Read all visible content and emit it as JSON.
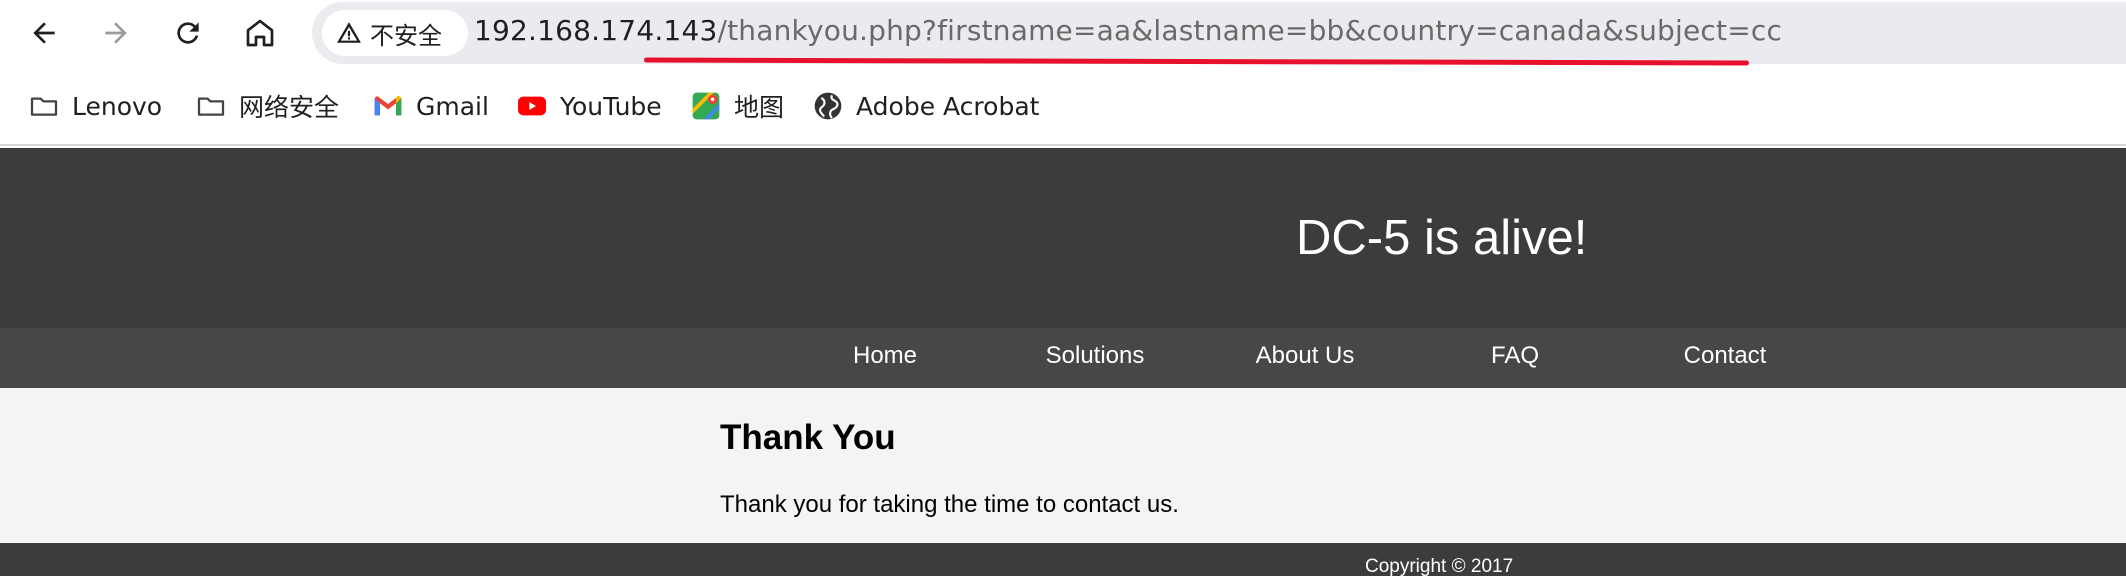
{
  "browser": {
    "security_label": "不安全",
    "url_host": "192.168.174.143",
    "url_path": "/thankyou.php?firstname=aa&lastname=bb&country=canada&subject=cc",
    "annotation_color": "#e8112d",
    "icons": [
      "back-arrow-icon",
      "forward-arrow-icon",
      "reload-icon",
      "home-icon",
      "warning-triangle-icon"
    ]
  },
  "bookmarks": [
    {
      "label": "Lenovo",
      "icon": "folder-icon"
    },
    {
      "label": "网络安全",
      "icon": "folder-icon"
    },
    {
      "label": "Gmail",
      "icon": "gmail-icon"
    },
    {
      "label": "YouTube",
      "icon": "youtube-icon"
    },
    {
      "label": "地图",
      "icon": "maps-icon"
    },
    {
      "label": "Adobe Acrobat",
      "icon": "globe-icon"
    }
  ],
  "site": {
    "title": "DC-5 is alive!",
    "nav": [
      "Home",
      "Solutions",
      "About Us",
      "FAQ",
      "Contact"
    ],
    "heading": "Thank You",
    "message": "Thank you for taking the time to contact us.",
    "footer": "Copyright © 2017"
  },
  "colors": {
    "header_bg": "#3c3c3c",
    "nav_bg": "#474747",
    "content_bg": "#f4f4f4"
  }
}
